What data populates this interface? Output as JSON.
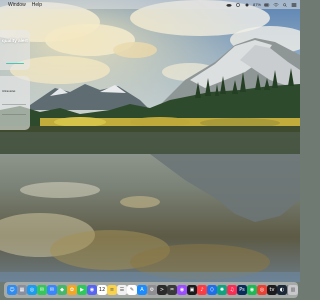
{
  "menubar": {
    "items": [
      "Window",
      "Help"
    ],
    "status_text": "87%"
  },
  "widgets": {
    "air_quality": {
      "title": "quality alert",
      "subtitle": "",
      "value": ""
    },
    "sun": {
      "label": "Ultraviolet",
      "value": "",
      "row_1": "",
      "row_2": ""
    }
  },
  "dock": {
    "calendar": {
      "month": "",
      "day": "12"
    },
    "apps": [
      {
        "name": "finder-icon",
        "glyph": "☺",
        "color": "#2f8cf0"
      },
      {
        "name": "launchpad-icon",
        "glyph": "▦",
        "color": "#888fa0"
      },
      {
        "name": "safari-icon",
        "glyph": "◎",
        "color": "#1d9bf0"
      },
      {
        "name": "messages-icon",
        "glyph": "✉",
        "color": "#35c759"
      },
      {
        "name": "mail-icon",
        "glyph": "✉",
        "color": "#3a86ff"
      },
      {
        "name": "maps-icon",
        "glyph": "◆",
        "color": "#43b86c"
      },
      {
        "name": "photos-icon",
        "glyph": "✿",
        "color": "#f5a623"
      },
      {
        "name": "facetime-icon",
        "glyph": "▶",
        "color": "#2ec95a"
      },
      {
        "name": "discord-icon",
        "glyph": "◉",
        "color": "#5865f2"
      },
      {
        "name": "calendar-icon",
        "glyph": "",
        "color": "#ffffff"
      },
      {
        "name": "notes-icon",
        "glyph": "≡",
        "color": "#f7d24a"
      },
      {
        "name": "reminders-icon",
        "glyph": "☰",
        "color": "#f0f0f0"
      },
      {
        "name": "freeform-icon",
        "glyph": "✎",
        "color": "#ffffff"
      },
      {
        "name": "appstore-icon",
        "glyph": "A",
        "color": "#1a8cff"
      },
      {
        "name": "settings-icon",
        "glyph": "⚙",
        "color": "#8e8e93"
      },
      {
        "name": "terminal-icon",
        "glyph": ">",
        "color": "#2b2b2b"
      },
      {
        "name": "activity-icon",
        "glyph": "♒",
        "color": "#3a3a3a"
      },
      {
        "name": "podcasts-icon",
        "glyph": "◉",
        "color": "#9b4dff"
      },
      {
        "name": "tv-icon",
        "glyph": "▣",
        "color": "#1c1c1e"
      },
      {
        "name": "music-app-icon",
        "glyph": "♪",
        "color": "#fc3c44"
      },
      {
        "name": "vscode-icon",
        "glyph": "⟨⟩",
        "color": "#1f6feb"
      },
      {
        "name": "chatgpt-icon",
        "glyph": "✺",
        "color": "#10a37f"
      },
      {
        "name": "music-icon",
        "glyph": "♫",
        "color": "#fa2d55"
      },
      {
        "name": "photoshop-icon",
        "glyph": "Ps",
        "color": "#0b2d5c"
      },
      {
        "name": "spotify-icon",
        "glyph": "◉",
        "color": "#1db954"
      },
      {
        "name": "chrome-icon",
        "glyph": "◎",
        "color": "#e94235"
      },
      {
        "name": "tv-app-icon",
        "glyph": "tv",
        "color": "#1c1c1e"
      },
      {
        "name": "steam-icon",
        "glyph": "◐",
        "color": "#1b2838"
      },
      {
        "name": "trash-icon",
        "glyph": "▥",
        "color": "#c7c7cc"
      }
    ]
  },
  "colors": {
    "sky_top": "#5f87b5",
    "cloud": "#e9ecef",
    "mountain": "#cfd3d4",
    "forest": "#2c4a2a",
    "autumn": "#c8b23a",
    "water": "#8c8f86"
  }
}
